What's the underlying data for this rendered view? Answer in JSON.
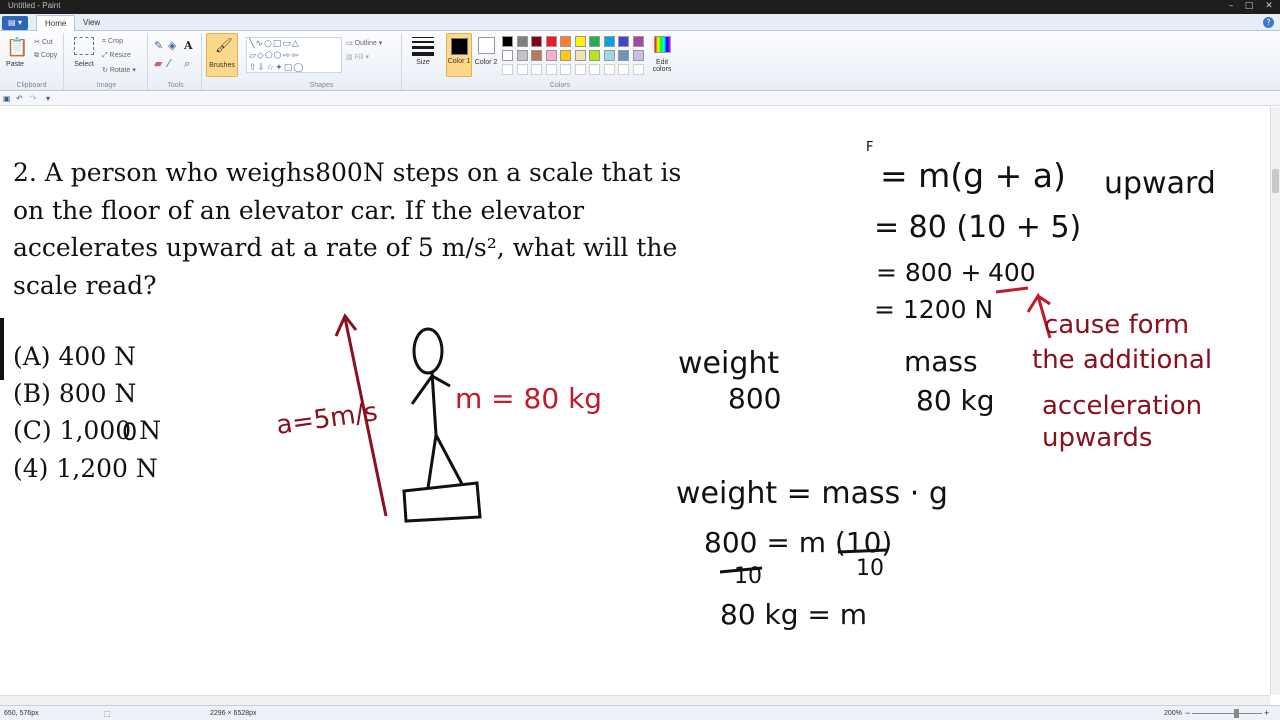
{
  "window": {
    "title": "Untitled - Paint",
    "controls": [
      "–",
      "□",
      "✕"
    ]
  },
  "tabs": {
    "app_menu": "▤ ▾",
    "home": "Home",
    "view": "View"
  },
  "ribbon": {
    "clipboard": {
      "paste": "Paste",
      "cut": "Cut",
      "copy": "Copy",
      "label": "Clipboard"
    },
    "image": {
      "select": "Select",
      "crop": "Crop",
      "resize": "Resize",
      "rotate": "Rotate",
      "label": "Image"
    },
    "tools": {
      "label": "Tools"
    },
    "brushes": {
      "label": "Brushes"
    },
    "shapes": {
      "outline": "Outline",
      "fill": "Fill",
      "label": "Shapes"
    },
    "size": {
      "label": "Size"
    },
    "color1": {
      "label": "Color 1"
    },
    "color2": {
      "label": "Color 2"
    },
    "edit_colors": {
      "label": "Edit colors"
    },
    "colors": {
      "label": "Colors",
      "row1": [
        "#000000",
        "#7f7f7f",
        "#880015",
        "#ed1c24",
        "#ff7f27",
        "#fff200",
        "#22b14c",
        "#00a2e8",
        "#3f48cc",
        "#a349a4"
      ],
      "row2": [
        "#ffffff",
        "#c3c3c3",
        "#b97a57",
        "#ffaec9",
        "#ffc90e",
        "#efe4b0",
        "#b5e61d",
        "#99d9ea",
        "#7092be",
        "#c8bfe7"
      ]
    }
  },
  "problem": {
    "lines": [
      "2. A person who weighs800N steps on a scale that is",
      "on the floor of an elevator car. If the elevator",
      "accelerates upward at a rate of 5 m/s², what will the",
      "scale read?"
    ],
    "choices": [
      "(A) 400 N",
      "(B) 800 N",
      "(C) 1,000 N",
      "(4) 1,200 N"
    ]
  },
  "handwriting": {
    "accel_label": "a=5m/s",
    "mass_label": "m = 80 kg",
    "stray_mark": "0",
    "f_mark": "F",
    "eq1": "= m(g + a)",
    "upward": "upward",
    "eq2": "= 80 (10 + 5)",
    "eq3a": "= 800 +",
    "eq3b": "400",
    "eq4": "= 1200 N",
    "cause": [
      "cause form",
      "the additional",
      "acceleration",
      "upwards"
    ],
    "weight": "weight",
    "weight_val": "800",
    "mass": "mass",
    "mass_val": "80 kg",
    "formula": "weight = mass  ·  g",
    "sub1": "800 = m (10)",
    "den1": "10",
    "den2": "10",
    "result": "80 kg = m"
  },
  "status": {
    "cursor": "650, 576px",
    "dimensions": "2296 × 6528px",
    "zoom": "200%"
  }
}
